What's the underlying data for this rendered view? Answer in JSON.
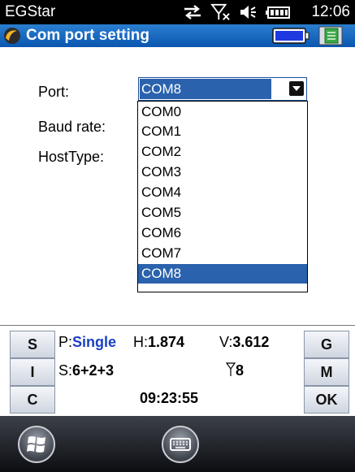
{
  "status_bar": {
    "app_name": "EGStar",
    "time": "12:06",
    "icons": [
      "sync-arrows-icon",
      "signal-off-icon",
      "speaker-muted-icon",
      "battery-icon"
    ]
  },
  "title_bar": {
    "title": "Com port setting",
    "icons": [
      "app-icon",
      "battery-indicator-icon",
      "notebook-icon"
    ]
  },
  "form": {
    "port_label": "Port:",
    "baud_label": "Baud rate:",
    "hosttype_label": "HostType:",
    "port_value": "COM8",
    "port_options": [
      "COM0",
      "COM1",
      "COM2",
      "COM3",
      "COM4",
      "COM5",
      "COM6",
      "COM7",
      "COM8"
    ],
    "selected_index": 8
  },
  "status_panel": {
    "buttons_left": [
      "S",
      "I",
      "C"
    ],
    "buttons_right": [
      "G",
      "M",
      "OK"
    ],
    "p_label": "P:",
    "p_value": "Single",
    "h_label": "H:",
    "h_value": "1.874",
    "v_label": "V:",
    "v_value": "3.612",
    "s_label": "S:",
    "s_value": "6+2+3",
    "sat_count": "8",
    "clock": "09:23:55"
  },
  "taskbar": {
    "icons": [
      "windows-start-icon",
      "keyboard-icon"
    ]
  },
  "colors": {
    "title_bar": "#0a56b0",
    "selection": "#2a62ad",
    "solution_text": "#1a3fc4"
  }
}
